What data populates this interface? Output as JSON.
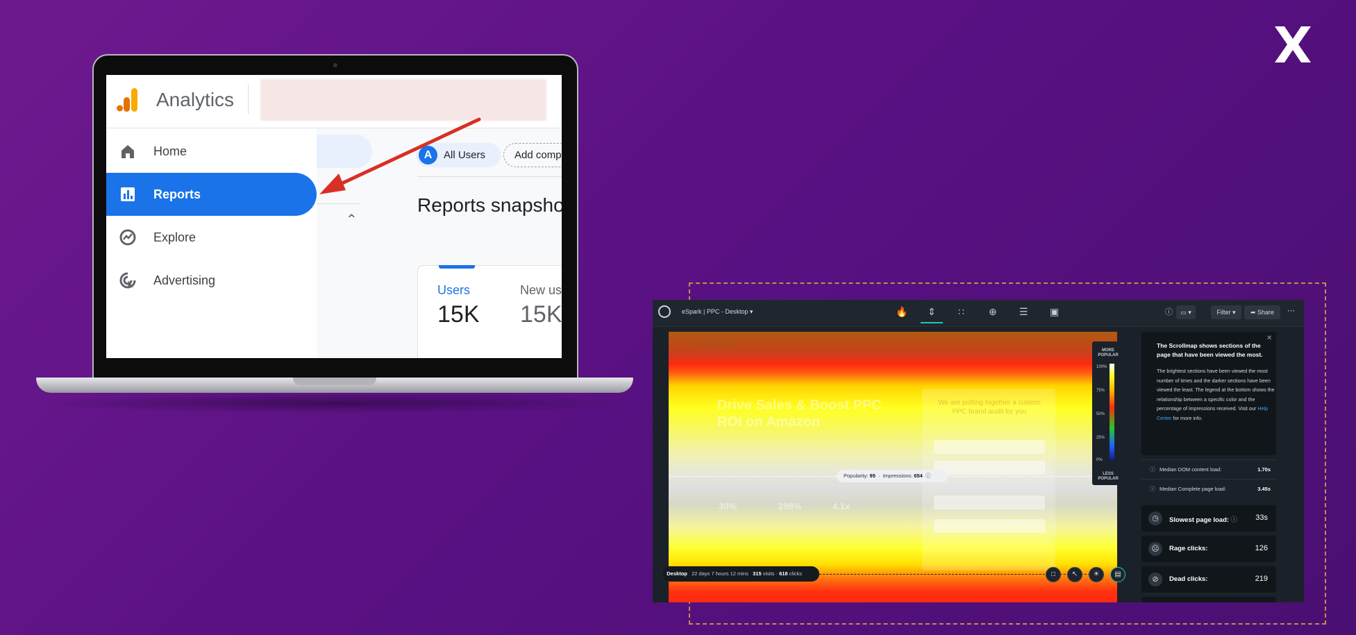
{
  "brand": {
    "logo_icon": "x-logo-icon"
  },
  "analytics": {
    "app_title": "Analytics",
    "nav": [
      {
        "label": "Home",
        "icon": "home-icon"
      },
      {
        "label": "Reports",
        "icon": "reports-icon",
        "active": true
      },
      {
        "label": "Explore",
        "icon": "explore-icon"
      },
      {
        "label": "Advertising",
        "icon": "advertising-icon"
      }
    ],
    "chip_letter": "A",
    "chip_users": "All Users",
    "chip_add": "Add comp",
    "heading": "Reports snapsho",
    "card": {
      "users_label": "Users",
      "users_value": "15K",
      "new_label": "New us",
      "new_value": "15K"
    },
    "accent_color": "#1a73e8",
    "arrow_color": "#d93025"
  },
  "heatmap": {
    "title": "eSpark | PPC - Desktop",
    "filter_label": "Filter",
    "share_label": "Share",
    "toolbar_icons": [
      "flame-icon",
      "scrollmap-icon",
      "grid-icon",
      "plus-circle-icon",
      "list-icon",
      "video-icon"
    ],
    "page_overlay": {
      "logo": "eSpark",
      "headline": "Drive Sales & Boost PPC ROI on Amazon",
      "form_title": "We are putting together a custom PPC brand audit for you",
      "stats": [
        "30%",
        "298%",
        "4.1x"
      ]
    },
    "popularity_label": "Popularity:",
    "popularity_value": "95",
    "impressions_label": "Impressions:",
    "impressions_value": "654",
    "legend": {
      "top": "MORE POPULAR",
      "bottom": "LESS POPULAR",
      "ticks": [
        "100%",
        "75%",
        "50%",
        "25%",
        "0%"
      ]
    },
    "bottombar": {
      "device": "Desktop",
      "duration": "22 days 7 hours 12 mins",
      "visits": "315",
      "visits_label": "visits",
      "clicks": "618",
      "clicks_label": "clicks"
    },
    "info_panel": {
      "title": "The Scrollmap shows sections of the page that have been viewed the most.",
      "body": "The brightest sections have been viewed the most number of times and the darker sections have been viewed the least. The legend at the bottom shows the relationship between a specific color and the percentage of impressions received. Visit our",
      "link": "Help Center",
      "body_tail": "for more info."
    },
    "metrics_small": [
      {
        "label": "Median DOM content load:",
        "value": "1.70s"
      },
      {
        "label": "Median Complete page load:",
        "value": "3.45s"
      }
    ],
    "metric_cards": [
      {
        "label": "Slowest page load:",
        "value": "33s",
        "icon": "speedometer-icon"
      },
      {
        "label": "Rage clicks:",
        "value": "126",
        "icon": "angry-face-icon"
      },
      {
        "label": "Dead clicks:",
        "value": "219",
        "icon": "no-entry-icon"
      }
    ],
    "accent_color": "#1ec8b4"
  }
}
